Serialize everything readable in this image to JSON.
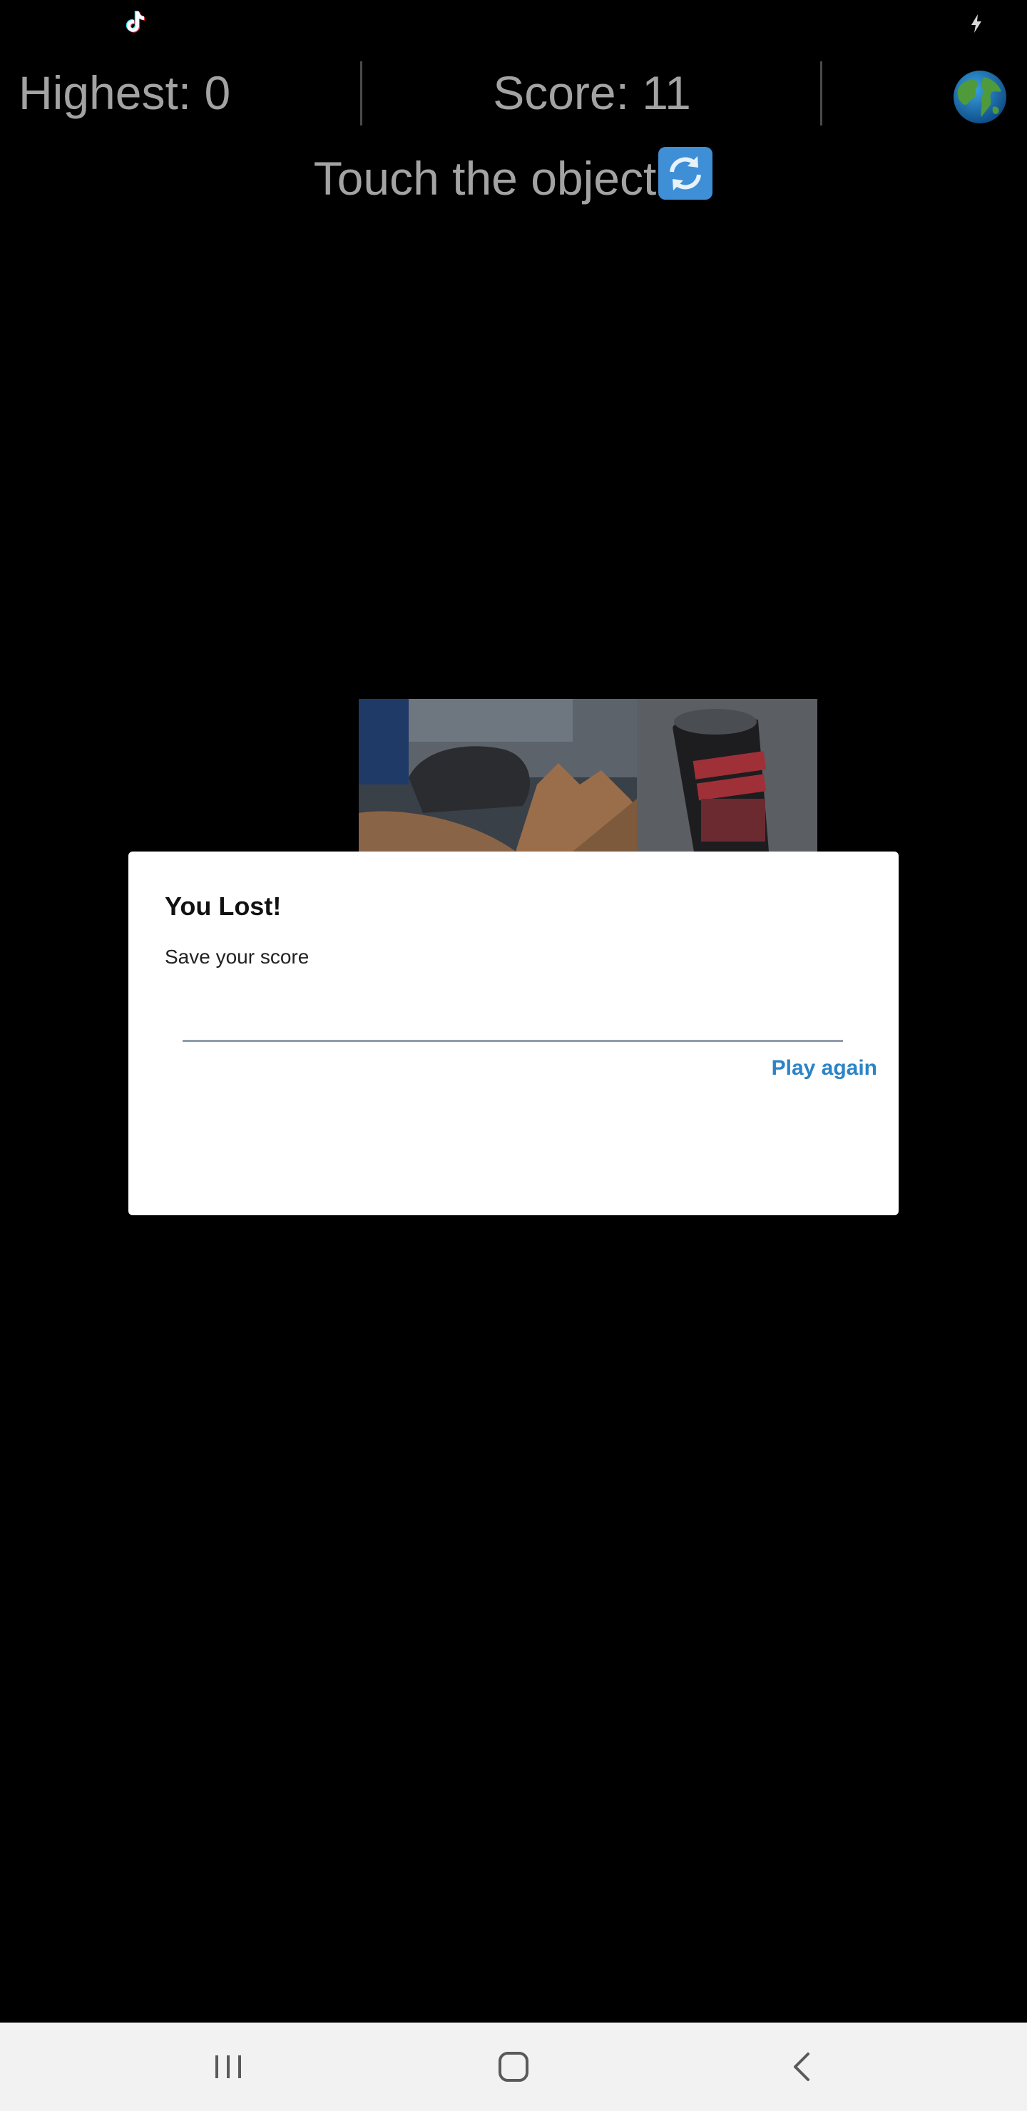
{
  "status_bar": {
    "left_icon": "tiktok-icon",
    "right_icon": "charging-icon"
  },
  "header": {
    "highest_label": "Highest: 0",
    "score_label": "Score: 11",
    "globe_icon": "globe-icon"
  },
  "instruction": {
    "text": "Touch the object",
    "icon": "refresh-icon"
  },
  "dialog": {
    "title": "You Lost!",
    "message": "Save your score",
    "input_value": "",
    "play_again_label": "Play again"
  },
  "nav_bar": {
    "recents_icon": "recents-icon",
    "home_icon": "home-icon",
    "back_icon": "back-icon"
  },
  "colors": {
    "background": "#000000",
    "header_text": "#a3a3a3",
    "dialog_background": "#ffffff",
    "accent": "#2b84c6",
    "nav_bar": "#f2f2f2"
  }
}
